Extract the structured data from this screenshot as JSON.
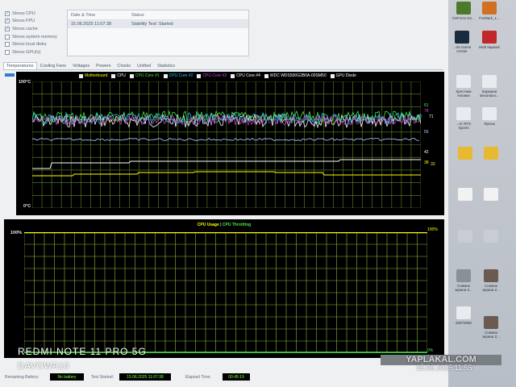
{
  "checks": [
    {
      "label": "Stress CPU",
      "checked": true
    },
    {
      "label": "Stress FPU",
      "checked": true
    },
    {
      "label": "Stress cache",
      "checked": true
    },
    {
      "label": "Stress system memory",
      "checked": false
    },
    {
      "label": "Stress local disks",
      "checked": false
    },
    {
      "label": "Stress GPU(s)",
      "checked": false
    }
  ],
  "info": {
    "col1": "Date & Time",
    "col2": "Status",
    "date": "15.06.2025 11:07:38",
    "status": "Stability Test: Started"
  },
  "tabs": [
    "Temperatures",
    "Cooling Fans",
    "Voltages",
    "Powers",
    "Clocks",
    "Unified",
    "Statistics"
  ],
  "temp_graph": {
    "legend": [
      {
        "name": "Motherboard",
        "color": "#ffff00"
      },
      {
        "name": "CPU",
        "color": "#ffffff"
      },
      {
        "name": "CPU Core #1",
        "color": "#48e848"
      },
      {
        "name": "CPU Core #2",
        "color": "#27c8e8"
      },
      {
        "name": "CPU Core #3",
        "color": "#e040e0"
      },
      {
        "name": "CPU Core #4",
        "color": "#ffffff"
      },
      {
        "name": "WDC  WDS500G2B0A-00SM50",
        "color": "#ffffff"
      },
      {
        "name": "GPU Diode",
        "color": "#ffffff"
      }
    ],
    "ymax": "100°C",
    "ymin": "0°C",
    "right_values": [
      "81",
      "78",
      "72",
      "71",
      "55",
      "42",
      "38",
      "33"
    ]
  },
  "usage_graph": {
    "legend_a": "CPU Usage",
    "legend_sep": "|",
    "legend_b": "CPU Throttling",
    "ymax": "100%",
    "ymin": "0%",
    "right_top": "100%",
    "right_bottom": "0%"
  },
  "status_bar": {
    "battery_label": "Remaining Battery:",
    "battery_value": "No battery",
    "started_label": "Test Started:",
    "started_value": "15.06.2025 11:07:38",
    "elapsed_label": "Elapsed Time:",
    "elapsed_value": "00:45:19"
  },
  "desktop": {
    "icons": [
      "GeForce Ex...",
      "FurMark_1...",
      "...tra Game Center",
      "Мой ящиков",
      "Крестики Нолики",
      "Кармани Безопасн...",
      "...ет RTS Sports",
      "Ярлык",
      "Снимок экрана 2...",
      "Снимок экрана 2...",
      "20072082",
      "Снимок экрана 2..."
    ]
  },
  "overlay": {
    "phone": "REDMI NOTE 11 PRO 5G",
    "user": "DAVOWA10",
    "watermark": "YAPLAKAL.COM",
    "datetime": "15.06.2025   11:55"
  }
}
